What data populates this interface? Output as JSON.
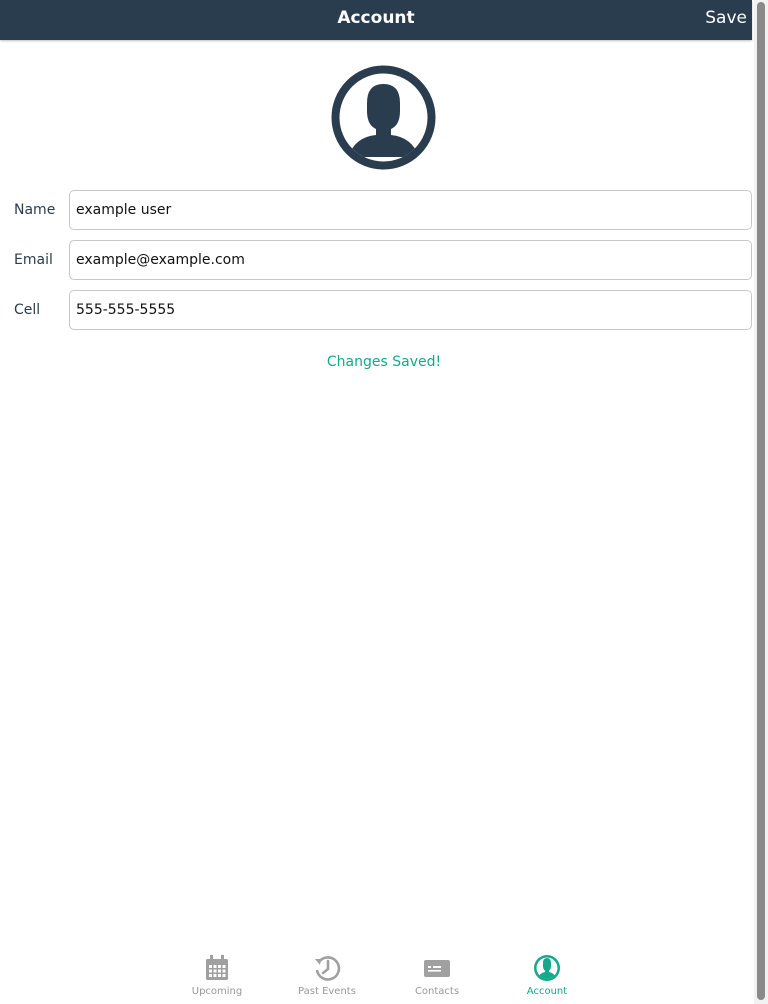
{
  "header": {
    "title": "Account",
    "save_label": "Save"
  },
  "avatar": {
    "icon": "user-avatar-icon",
    "color": "#2a3d4f"
  },
  "form": {
    "fields": [
      {
        "label": "Name",
        "value": "example user"
      },
      {
        "label": "Email",
        "value": "example@example.com"
      },
      {
        "label": "Cell",
        "value": "555-555-5555"
      }
    ]
  },
  "status_message": "Changes Saved!",
  "tabbar": {
    "tabs": [
      {
        "label": "Upcoming",
        "icon": "calendar-icon",
        "active": false
      },
      {
        "label": "Past Events",
        "icon": "history-icon",
        "active": false
      },
      {
        "label": "Contacts",
        "icon": "contact-card-icon",
        "active": false
      },
      {
        "label": "Account",
        "icon": "account-icon",
        "active": true
      }
    ]
  },
  "colors": {
    "header_bg": "#2a3d4f",
    "accent": "#14a98b",
    "inactive_tab": "#999999"
  }
}
